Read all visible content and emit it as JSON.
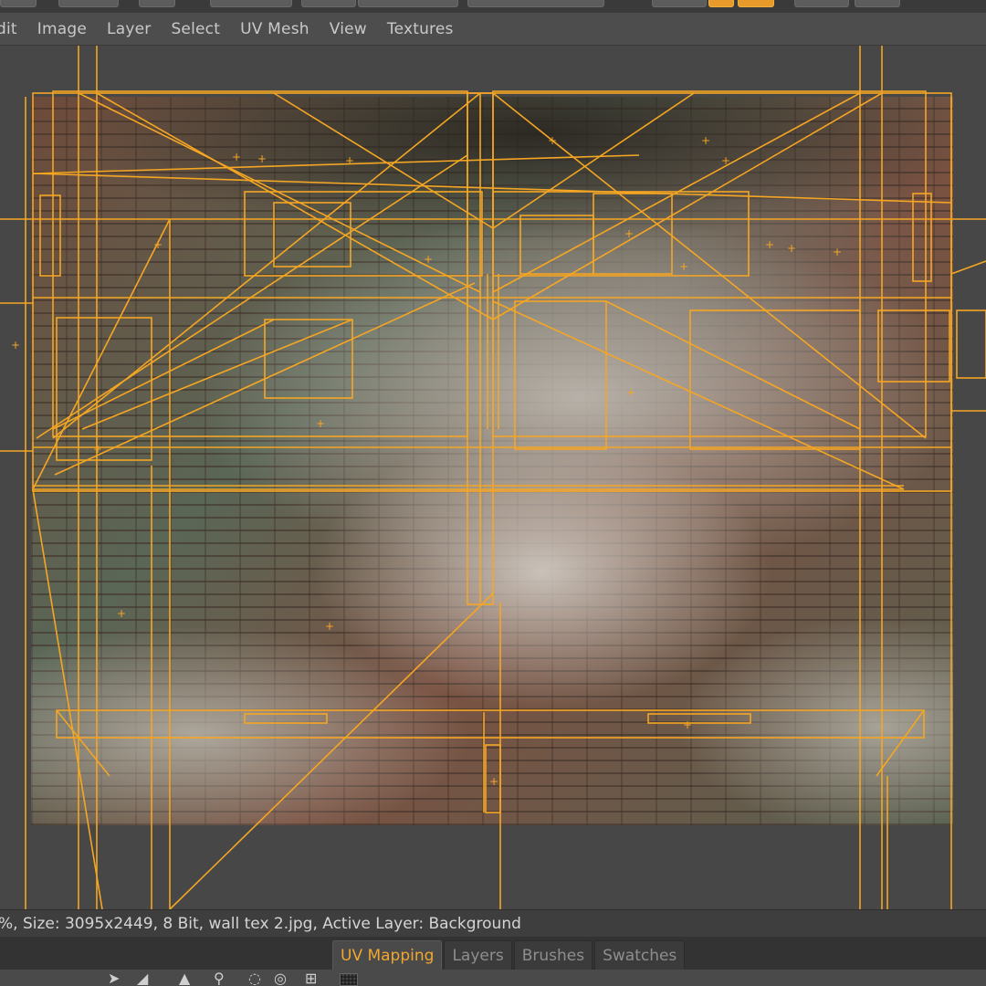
{
  "menu": {
    "items": [
      "dit",
      "Image",
      "Layer",
      "Select",
      "UV Mesh",
      "View",
      "Textures"
    ]
  },
  "status": {
    "text": "%, Size: 3095x2449, 8 Bit, wall tex 2.jpg, Active Layer: Background"
  },
  "tabs": [
    {
      "label": "UV Mapping",
      "active": true
    },
    {
      "label": "Layers",
      "active": false
    },
    {
      "label": "Brushes",
      "active": false
    },
    {
      "label": "Swatches",
      "active": false
    }
  ],
  "icons": {
    "arrow": "cursor-arrow-icon",
    "triangle": "triangle-icon",
    "pin": "pin-icon",
    "lock": "lock-icon",
    "target": "target-icon",
    "add": "add-icon",
    "grid": "grid-icon"
  },
  "colors": {
    "accent": "#f0a830",
    "uv_lines": "#f5a623",
    "panel_bg": "#4a4a4a"
  }
}
